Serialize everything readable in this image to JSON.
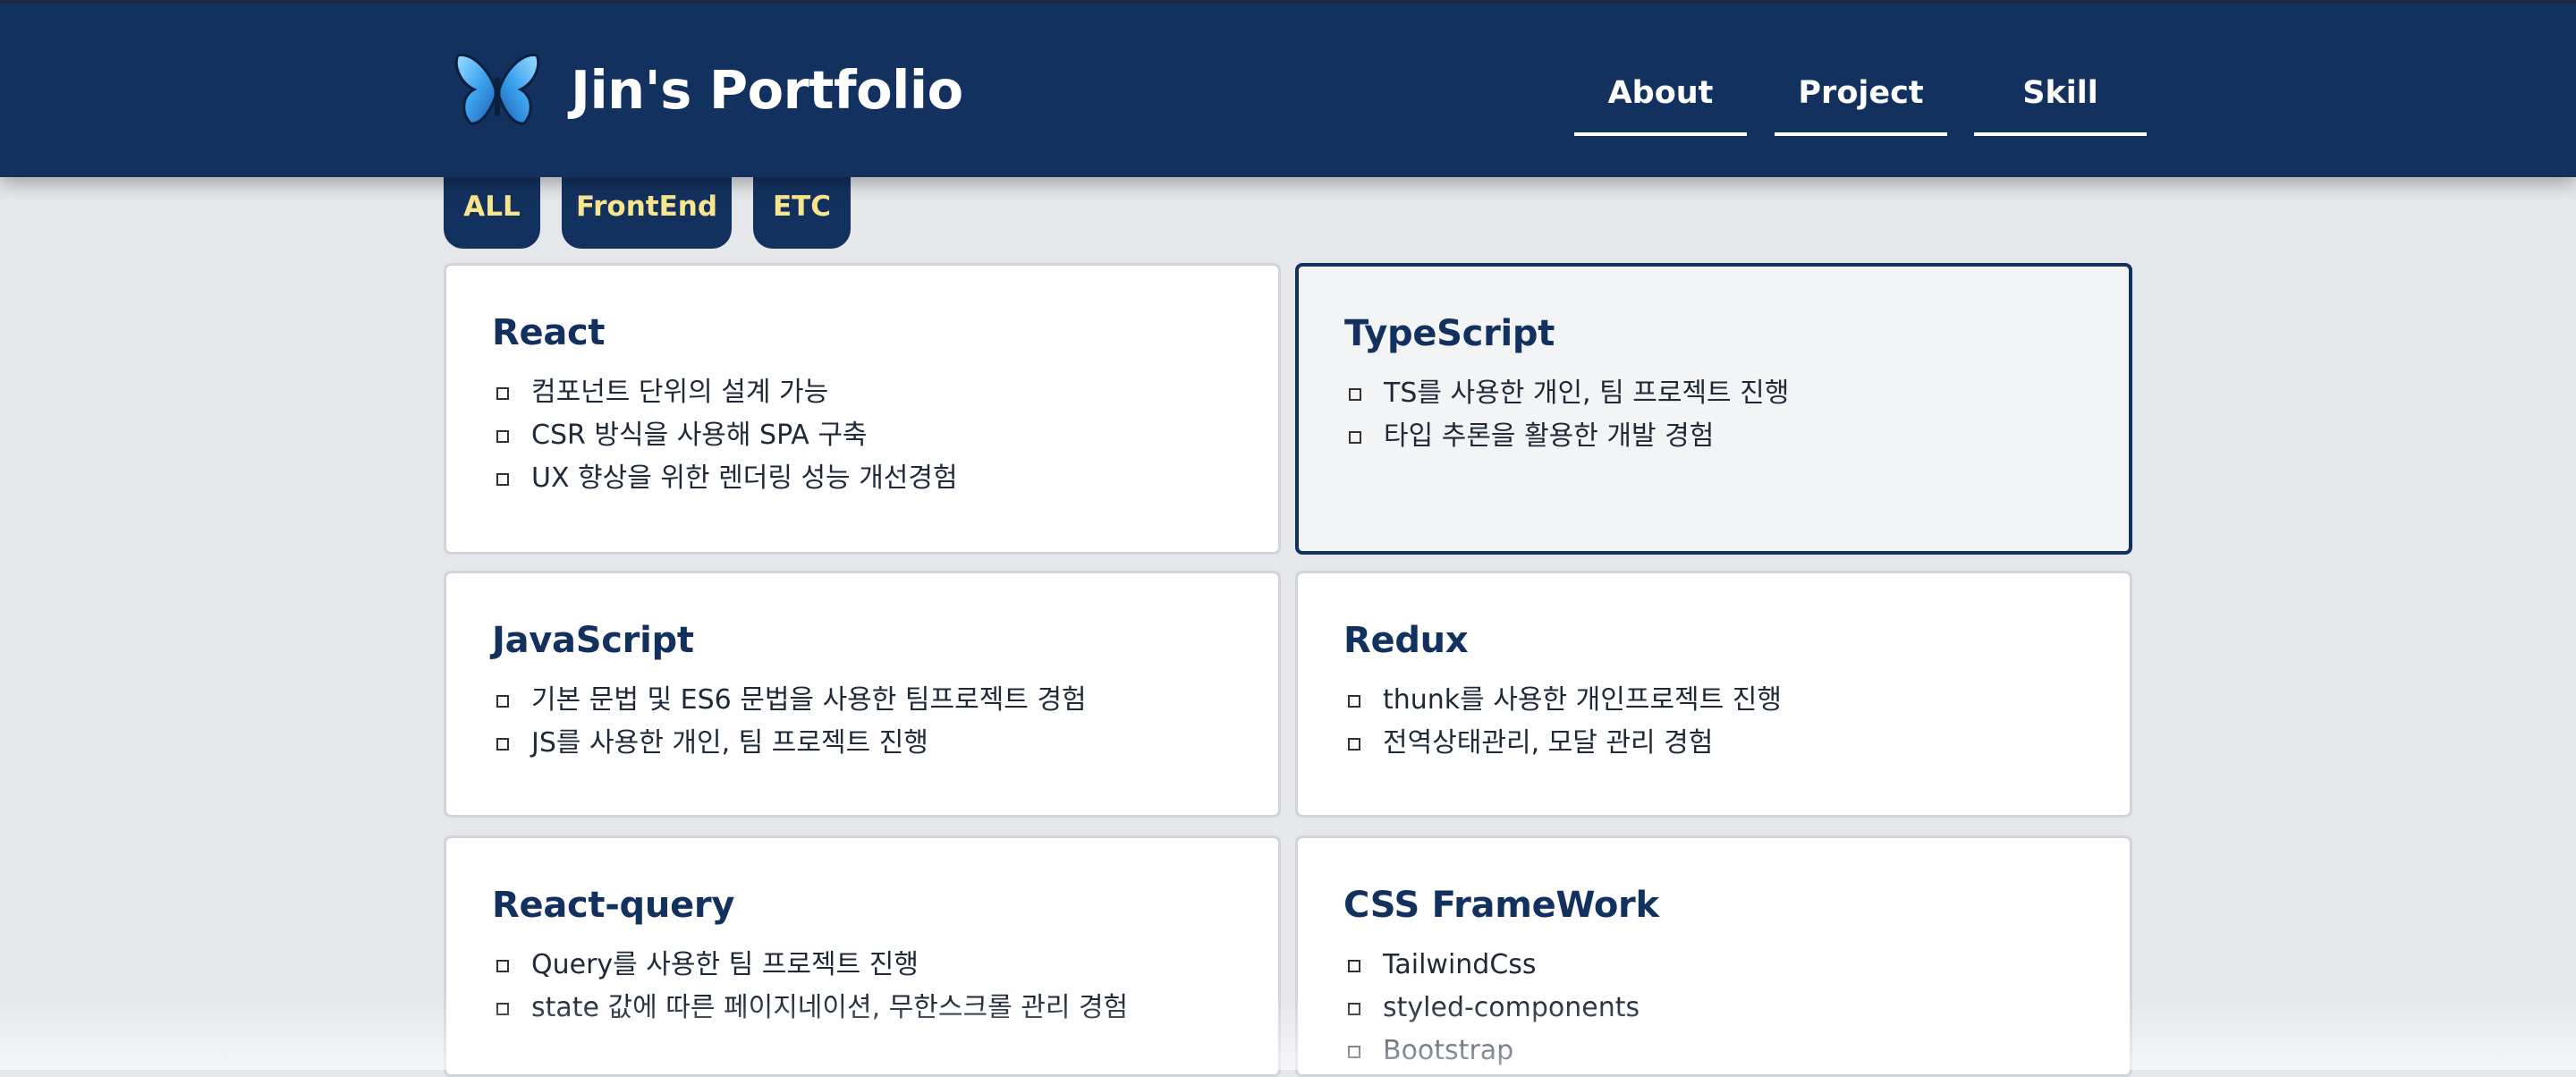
{
  "header": {
    "title": "Jin's Portfolio",
    "logo_icon": "butterfly-icon",
    "background": "#13315f",
    "nav": [
      {
        "label": "About"
      },
      {
        "label": "Project"
      },
      {
        "label": "Skill"
      }
    ]
  },
  "filters": [
    {
      "label": "ALL"
    },
    {
      "label": "FrontEnd"
    },
    {
      "label": "ETC"
    }
  ],
  "skills": [
    {
      "title": "React",
      "items": [
        "컴포넌트 단위의 설계 가능",
        "CSR 방식을 사용해 SPA 구축",
        "UX 향상을 위한 렌더링 성능 개선경험"
      ]
    },
    {
      "title": "TypeScript",
      "items": [
        "TS를 사용한 개인, 팀 프로젝트 진행",
        "타입 추론을 활용한 개발 경험"
      ]
    },
    {
      "title": "JavaScript",
      "items": [
        "기본 문법 및 ES6 문법을 사용한 팀프로젝트 경험",
        "JS를 사용한 개인, 팀 프로젝트 진행"
      ]
    },
    {
      "title": "Redux",
      "items": [
        "thunk를 사용한 개인프로젝트 진행",
        "전역상태관리, 모달 관리 경험"
      ]
    },
    {
      "title": "React-query",
      "items": [
        "Query를 사용한 팀 프로젝트 진행",
        "state 값에 따른 페이지네이션, 무한스크롤 관리 경험"
      ]
    },
    {
      "title": "CSS FrameWork",
      "items": [
        "TailwindCss",
        "styled-components",
        "Bootstrap"
      ]
    }
  ],
  "colors": {
    "accent": "#13315f",
    "filter_text": "#f8e58c",
    "page_bg": "#e5e7eb"
  }
}
